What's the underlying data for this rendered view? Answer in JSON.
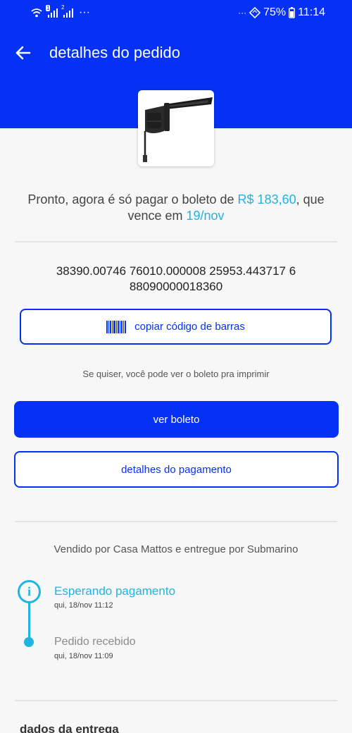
{
  "status_bar": {
    "dots_left": "···",
    "dots_right": "···",
    "battery": "75%",
    "time": "11:14",
    "sim1": "1",
    "sim2": "2"
  },
  "header": {
    "title": "detalhes do pedido"
  },
  "payment": {
    "text_before": "Pronto, agora é só pagar o boleto de ",
    "amount": "R$ 183,60",
    "text_middle": ", que vence em ",
    "due_date": "19/nov",
    "barcode_number": "38390.00746  76010.000008  25953.443717  6\n88090000018360",
    "copy_button_label": "copiar código de barras",
    "hint": "Se quiser, você pode ver o boleto pra imprimir",
    "view_button_label": "ver boleto",
    "details_button_label": "detalhes do pagamento"
  },
  "seller_info": "Vendido por Casa Mattos e entregue por Submarino",
  "timeline": [
    {
      "title": "Esperando pagamento",
      "date": "qui, 18/nov 11:12"
    },
    {
      "title": "Pedido recebido",
      "date": "qui, 18/nov 11:09"
    }
  ],
  "delivery_section_title": "dados da entrega",
  "colors": {
    "brand_blue": "#0531f5",
    "accent_cyan": "#1fb4e2",
    "background": "#f7f7f7"
  },
  "icons": {
    "back": "arrow-left-icon",
    "barcode": "barcode-icon",
    "info": "info-icon"
  }
}
